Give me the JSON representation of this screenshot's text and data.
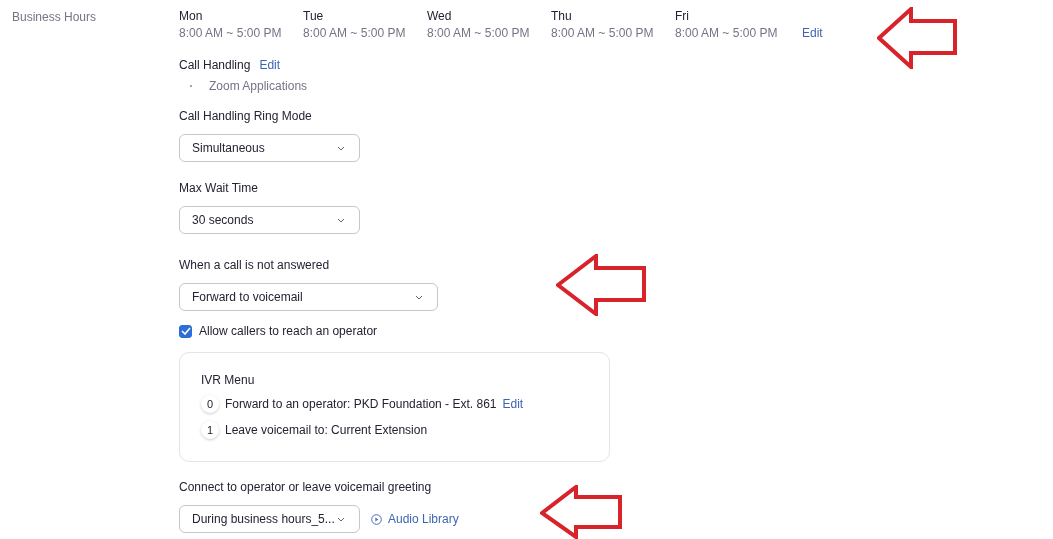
{
  "business_hours": {
    "label": "Business Hours",
    "days": [
      {
        "day": "Mon",
        "hours": "8:00 AM ~ 5:00 PM"
      },
      {
        "day": "Tue",
        "hours": "8:00 AM ~ 5:00 PM"
      },
      {
        "day": "Wed",
        "hours": "8:00 AM ~ 5:00 PM"
      },
      {
        "day": "Thu",
        "hours": "8:00 AM ~ 5:00 PM"
      },
      {
        "day": "Fri",
        "hours": "8:00 AM ~ 5:00 PM"
      }
    ],
    "edit": "Edit"
  },
  "call_handling": {
    "label": "Call Handling",
    "edit": "Edit",
    "items": [
      "Zoom Applications"
    ]
  },
  "ring_mode": {
    "label": "Call Handling Ring Mode",
    "value": "Simultaneous"
  },
  "max_wait": {
    "label": "Max Wait Time",
    "value": "30 seconds"
  },
  "not_answered": {
    "label": "When a call is not answered",
    "value": "Forward to voicemail"
  },
  "allow_operator": {
    "label": "Allow callers to reach an operator",
    "checked": true
  },
  "ivr_menu": {
    "title": "IVR Menu",
    "items": [
      {
        "key": "0",
        "text": "Forward to an operator: PKD Foundation - Ext. 861",
        "edit": "Edit"
      },
      {
        "key": "1",
        "text": "Leave voicemail to: Current Extension"
      }
    ]
  },
  "greeting": {
    "label": "Connect to operator or leave voicemail greeting",
    "value": "During business hours_5...",
    "link": "Audio Library"
  }
}
